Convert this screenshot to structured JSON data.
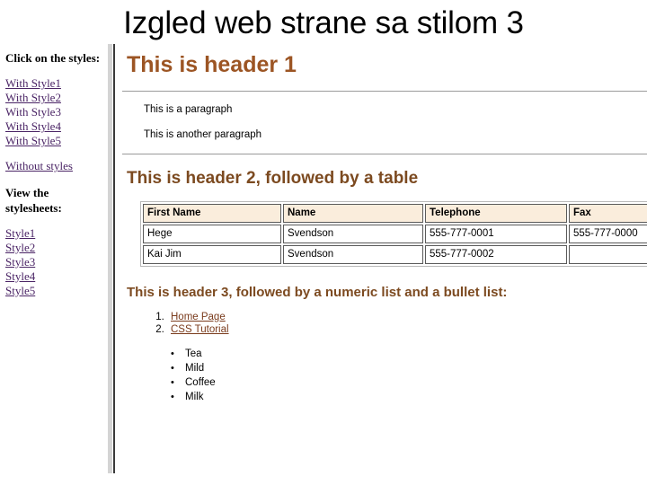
{
  "slide": {
    "title": "Izgled web strane sa stilom 3"
  },
  "sidebar": {
    "heading_click": "Click on the styles:",
    "style_links": [
      {
        "label": "With Style1",
        "underlined": true
      },
      {
        "label": "With Style2",
        "underlined": true
      },
      {
        "label": "With Style3",
        "underlined": false
      },
      {
        "label": "With Style4",
        "underlined": true
      },
      {
        "label": "With Style5",
        "underlined": true
      }
    ],
    "without_styles": "Without styles",
    "heading_view": "View the stylesheets:",
    "stylesheet_links": [
      {
        "label": "Style1"
      },
      {
        "label": "Style2"
      },
      {
        "label": "Style3"
      },
      {
        "label": "Style4"
      },
      {
        "label": "Style5"
      }
    ],
    "link_color": "#4b2566"
  },
  "main": {
    "header1": "This is header 1",
    "paragraph1": "This is a paragraph",
    "paragraph2": "This is another paragraph",
    "header2": "This is header 2, followed by a table",
    "header3": "This is header 3, followed by a numeric list and a bullet list:",
    "heading_color_h1": "#9c5524",
    "heading_color_h2": "#7c4a20",
    "table": {
      "columns": [
        "First Name",
        "Name",
        "Telephone",
        "Fax"
      ],
      "rows": [
        [
          "Hege",
          "Svendson",
          "555-777-0001",
          "555-777-0000"
        ],
        [
          "Kai Jim",
          "Svendson",
          "555-777-0002",
          ""
        ]
      ],
      "header_bg": "#faeddc"
    },
    "numeric_list": [
      {
        "label": "Home Page"
      },
      {
        "label": "CSS Tutorial"
      }
    ],
    "bullet_list": [
      {
        "label": "Tea"
      },
      {
        "label": "Mild"
      },
      {
        "label": "Coffee"
      },
      {
        "label": "Milk"
      }
    ],
    "list_link_color": "#7a3b1c",
    "bullet_glyph": "•"
  }
}
